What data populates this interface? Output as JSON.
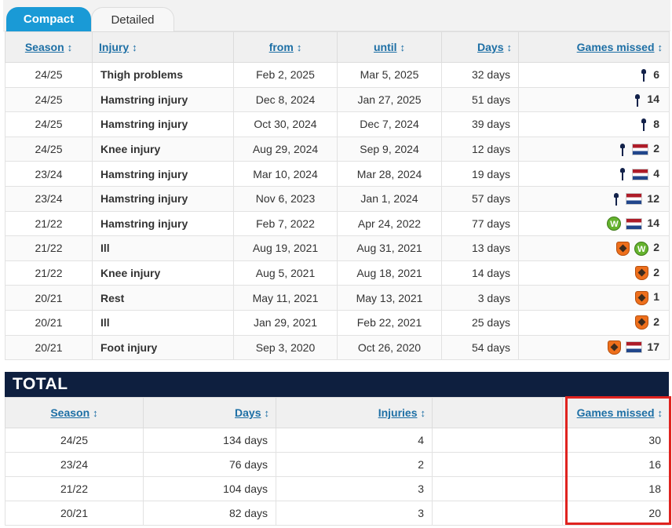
{
  "tabs": [
    "Compact",
    "Detailed"
  ],
  "injuries": {
    "headers": [
      "Season",
      "Injury",
      "from",
      "until",
      "Days",
      "Games missed"
    ],
    "sort_arrow": "↕",
    "rows": [
      {
        "season": "24/25",
        "injury": "Thigh problems",
        "from": "Feb 2, 2025",
        "until": "Mar 5, 2025",
        "days": "32 days",
        "icons": [
          "spurs"
        ],
        "games": "6"
      },
      {
        "season": "24/25",
        "injury": "Hamstring injury",
        "from": "Dec 8, 2024",
        "until": "Jan 27, 2025",
        "days": "51 days",
        "icons": [
          "spurs"
        ],
        "games": "14"
      },
      {
        "season": "24/25",
        "injury": "Hamstring injury",
        "from": "Oct 30, 2024",
        "until": "Dec 7, 2024",
        "days": "39 days",
        "icons": [
          "spurs"
        ],
        "games": "8"
      },
      {
        "season": "24/25",
        "injury": "Knee injury",
        "from": "Aug 29, 2024",
        "until": "Sep 9, 2024",
        "days": "12 days",
        "icons": [
          "spurs",
          "netherlands"
        ],
        "games": "2"
      },
      {
        "season": "23/24",
        "injury": "Hamstring injury",
        "from": "Mar 10, 2024",
        "until": "Mar 28, 2024",
        "days": "19 days",
        "icons": [
          "spurs",
          "netherlands"
        ],
        "games": "4"
      },
      {
        "season": "23/24",
        "injury": "Hamstring injury",
        "from": "Nov 6, 2023",
        "until": "Jan 1, 2024",
        "days": "57 days",
        "icons": [
          "spurs",
          "netherlands"
        ],
        "games": "12"
      },
      {
        "season": "21/22",
        "injury": "Hamstring injury",
        "from": "Feb 7, 2022",
        "until": "Apr 24, 2022",
        "days": "77 days",
        "icons": [
          "wolfsburg",
          "netherlands"
        ],
        "games": "14"
      },
      {
        "season": "21/22",
        "injury": "Ill",
        "from": "Aug 19, 2021",
        "until": "Aug 31, 2021",
        "days": "13 days",
        "icons": [
          "utrecht",
          "wolfsburg"
        ],
        "games": "2"
      },
      {
        "season": "21/22",
        "injury": "Knee injury",
        "from": "Aug 5, 2021",
        "until": "Aug 18, 2021",
        "days": "14 days",
        "icons": [
          "utrecht"
        ],
        "games": "2"
      },
      {
        "season": "20/21",
        "injury": "Rest",
        "from": "May 11, 2021",
        "until": "May 13, 2021",
        "days": "3 days",
        "icons": [
          "utrecht"
        ],
        "games": "1"
      },
      {
        "season": "20/21",
        "injury": "Ill",
        "from": "Jan 29, 2021",
        "until": "Feb 22, 2021",
        "days": "25 days",
        "icons": [
          "utrecht"
        ],
        "games": "2"
      },
      {
        "season": "20/21",
        "injury": "Foot injury",
        "from": "Sep 3, 2020",
        "until": "Oct 26, 2020",
        "days": "54 days",
        "icons": [
          "utrecht",
          "netherlands"
        ],
        "games": "17"
      }
    ]
  },
  "total": {
    "title": "TOTAL",
    "headers": [
      "Season",
      "Days",
      "Injuries",
      "Games missed"
    ],
    "rows": [
      {
        "season": "24/25",
        "days": "134 days",
        "injuries": "4",
        "games": "30"
      },
      {
        "season": "23/24",
        "days": "76 days",
        "injuries": "2",
        "games": "16"
      },
      {
        "season": "21/22",
        "days": "104 days",
        "injuries": "3",
        "games": "18"
      },
      {
        "season": "20/21",
        "days": "82 days",
        "injuries": "3",
        "games": "20"
      }
    ]
  },
  "colors": {
    "accent": "#1a9ad6",
    "total_bar": "#0e1f3f",
    "highlight": "#e0231f"
  }
}
